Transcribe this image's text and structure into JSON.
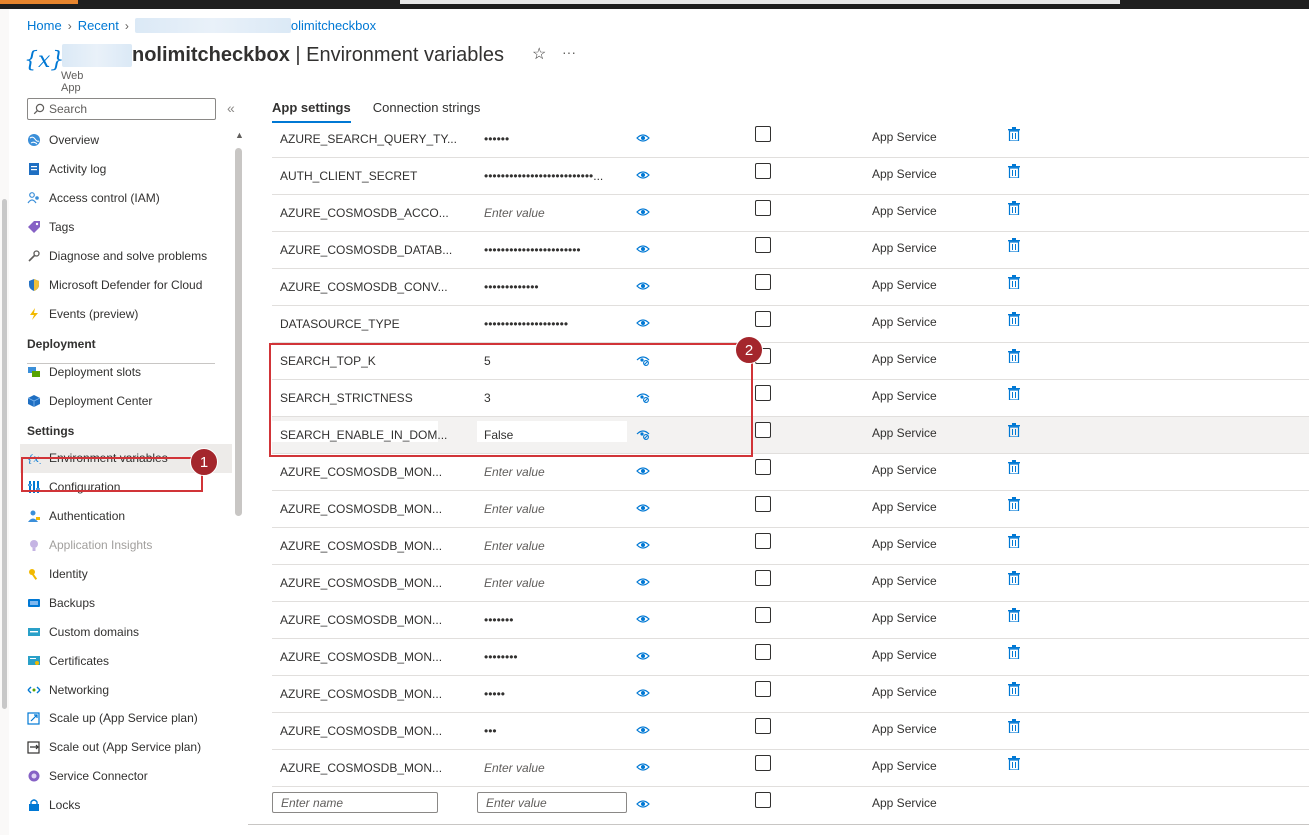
{
  "breadcrumb": {
    "home": "Home",
    "recent": "Recent",
    "resource": "olimitcheckbox"
  },
  "header": {
    "app_icon": "{x}",
    "title_name": "nolimitcheckbox",
    "title_rest": " | Environment variables",
    "subtitle": "Web App",
    "star_icon": "☆",
    "more_icon": "···"
  },
  "nav": {
    "search_placeholder": "Search",
    "collapse_icon": "«",
    "items_top": [
      {
        "label": "Overview",
        "icon": "globe-icon"
      },
      {
        "label": "Activity log",
        "icon": "log-icon"
      },
      {
        "label": "Access control (IAM)",
        "icon": "people-icon"
      },
      {
        "label": "Tags",
        "icon": "tag-icon"
      },
      {
        "label": "Diagnose and solve problems",
        "icon": "wrench-icon"
      },
      {
        "label": "Microsoft Defender for Cloud",
        "icon": "shield-icon"
      },
      {
        "label": "Events (preview)",
        "icon": "lightning-icon"
      }
    ],
    "deployment_heading": "Deployment",
    "items_deployment": [
      {
        "label": "Deployment slots",
        "icon": "slots-icon"
      },
      {
        "label": "Deployment Center",
        "icon": "cube-icon"
      }
    ],
    "settings_heading": "Settings",
    "items_settings": [
      {
        "label": "Environment variables",
        "icon": "variable-icon"
      },
      {
        "label": "Configuration",
        "icon": "sliders-icon"
      },
      {
        "label": "Authentication",
        "icon": "person-key-icon"
      },
      {
        "label": "Application Insights",
        "icon": "bulb-icon"
      },
      {
        "label": "Identity",
        "icon": "key-icon"
      },
      {
        "label": "Backups",
        "icon": "backup-icon"
      },
      {
        "label": "Custom domains",
        "icon": "domain-icon"
      },
      {
        "label": "Certificates",
        "icon": "certificate-icon"
      },
      {
        "label": "Networking",
        "icon": "network-icon"
      },
      {
        "label": "Scale up (App Service plan)",
        "icon": "scale-up-icon"
      },
      {
        "label": "Scale out (App Service plan)",
        "icon": "scale-out-icon"
      },
      {
        "label": "Service Connector",
        "icon": "connector-icon"
      },
      {
        "label": "Locks",
        "icon": "lock-icon"
      }
    ]
  },
  "annotations": {
    "badge1": "1",
    "badge2": "2"
  },
  "tabs": {
    "app_settings": "App settings",
    "connection_strings": "Connection strings"
  },
  "rows": [
    {
      "name": "AZURE_SEARCH_QUERY_TY...",
      "value": "••••••",
      "placeholder": false,
      "source": "App Service"
    },
    {
      "name": "AUTH_CLIENT_SECRET",
      "value": "••••••••••••••••••••••••••...",
      "placeholder": false,
      "source": "App Service"
    },
    {
      "name": "AZURE_COSMOSDB_ACCO...",
      "value": "Enter value",
      "placeholder": true,
      "source": "App Service"
    },
    {
      "name": "AZURE_COSMOSDB_DATAB...",
      "value": "•••••••••••••••••••••••",
      "placeholder": false,
      "source": "App Service"
    },
    {
      "name": "AZURE_COSMOSDB_CONV...",
      "value": "•••••••••••••",
      "placeholder": false,
      "source": "App Service"
    },
    {
      "name": "DATASOURCE_TYPE",
      "value": "••••••••••••••••••••",
      "placeholder": false,
      "source": "App Service"
    },
    {
      "name": "SEARCH_TOP_K",
      "value": "5",
      "placeholder": false,
      "source": "App Service"
    },
    {
      "name": "SEARCH_STRICTNESS",
      "value": "3",
      "placeholder": false,
      "source": "App Service"
    },
    {
      "name": "SEARCH_ENABLE_IN_DOM...",
      "value": "False",
      "placeholder": false,
      "source": "App Service"
    },
    {
      "name": "AZURE_COSMOSDB_MON...",
      "value": "Enter value",
      "placeholder": true,
      "source": "App Service"
    },
    {
      "name": "AZURE_COSMOSDB_MON...",
      "value": "Enter value",
      "placeholder": true,
      "source": "App Service"
    },
    {
      "name": "AZURE_COSMOSDB_MON...",
      "value": "Enter value",
      "placeholder": true,
      "source": "App Service"
    },
    {
      "name": "AZURE_COSMOSDB_MON...",
      "value": "Enter value",
      "placeholder": true,
      "source": "App Service"
    },
    {
      "name": "AZURE_COSMOSDB_MON...",
      "value": "•••••••",
      "placeholder": false,
      "source": "App Service"
    },
    {
      "name": "AZURE_COSMOSDB_MON...",
      "value": "••••••••",
      "placeholder": false,
      "source": "App Service"
    },
    {
      "name": "AZURE_COSMOSDB_MON...",
      "value": "•••••",
      "placeholder": false,
      "source": "App Service"
    },
    {
      "name": "AZURE_COSMOSDB_MON...",
      "value": "•••",
      "placeholder": false,
      "source": "App Service"
    },
    {
      "name": "AZURE_COSMOSDB_MON...",
      "value": "Enter value",
      "placeholder": true,
      "source": "App Service"
    }
  ],
  "new_row": {
    "name_placeholder": "Enter name",
    "value_placeholder": "Enter value",
    "source": "App Service"
  },
  "colors": {
    "accent": "#0078d4",
    "annotation": "#d13438",
    "badge": "#a4262c"
  }
}
